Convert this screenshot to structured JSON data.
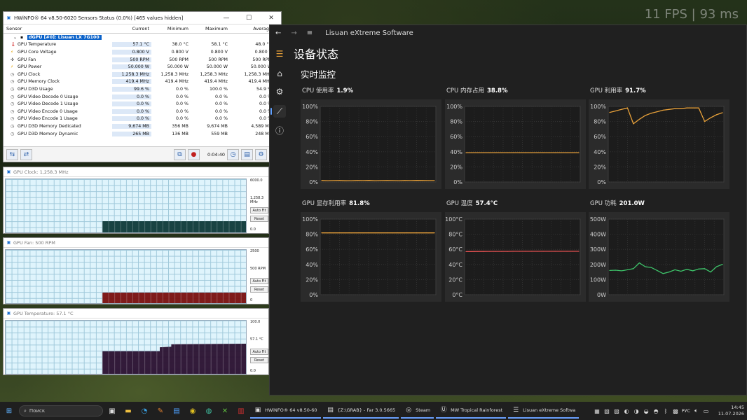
{
  "overlay": {
    "fps": "11 FPS | 93 ms"
  },
  "hwinfo": {
    "title": "HWiNFO® 64 v8.50-6020 Sensors Status (0.0%) [465 values hidden]",
    "columns": [
      "Sensor",
      "Current",
      "Minimum",
      "Maximum",
      "Average"
    ],
    "device": "dGPU [#0]: Lisuan LX 7G100",
    "rows": [
      {
        "name": "GPU Temperature",
        "icon": "thermometer-icon",
        "cur": "57.1 °C",
        "min": "38.0 °C",
        "max": "58.1 °C",
        "avg": "48.0 °C"
      },
      {
        "name": "GPU Core Voltage",
        "icon": "lightning-icon",
        "cur": "0.800 V",
        "min": "0.800 V",
        "max": "0.800 V",
        "avg": "0.800 V"
      },
      {
        "name": "GPU Fan",
        "icon": "fan-icon",
        "cur": "500 RPM",
        "min": "500 RPM",
        "max": "500 RPM",
        "avg": "500 RPM"
      },
      {
        "name": "GPU Power",
        "icon": "lightning-icon",
        "cur": "50.000 W",
        "min": "50.000 W",
        "max": "50.000 W",
        "avg": "50.000 W"
      },
      {
        "name": "GPU Clock",
        "icon": "clock-icon",
        "cur": "1,258.3 MHz",
        "min": "1,258.3 MHz",
        "max": "1,258.3 MHz",
        "avg": "1,258.3 MHz"
      },
      {
        "name": "GPU Memory Clock",
        "icon": "clock-icon",
        "cur": "419.4 MHz",
        "min": "419.4 MHz",
        "max": "419.4 MHz",
        "avg": "419.4 MHz"
      },
      {
        "name": "GPU D3D Usage",
        "icon": "clock-icon",
        "cur": "99.6 %",
        "min": "0.0 %",
        "max": "100.0 %",
        "avg": "54.9 %"
      },
      {
        "name": "GPU Video Decode 0 Usage",
        "icon": "clock-icon",
        "cur": "0.0 %",
        "min": "0.0 %",
        "max": "0.0 %",
        "avg": "0.0 %"
      },
      {
        "name": "GPU Video Decode 1 Usage",
        "icon": "clock-icon",
        "cur": "0.0 %",
        "min": "0.0 %",
        "max": "0.0 %",
        "avg": "0.0 %"
      },
      {
        "name": "GPU Video Encode 0 Usage",
        "icon": "clock-icon",
        "cur": "0.0 %",
        "min": "0.0 %",
        "max": "0.0 %",
        "avg": "0.0 %"
      },
      {
        "name": "GPU Video Encode 1 Usage",
        "icon": "clock-icon",
        "cur": "0.0 %",
        "min": "0.0 %",
        "max": "0.0 %",
        "avg": "0.0 %"
      },
      {
        "name": "GPU D3D Memory Dedicated",
        "icon": "clock-icon",
        "cur": "9,674 MB",
        "min": "356 MB",
        "max": "9,674 MB",
        "avg": "4,589 MB"
      },
      {
        "name": "GPU D3D Memory Dynamic",
        "icon": "clock-icon",
        "cur": "265 MB",
        "min": "136 MB",
        "max": "559 MB",
        "avg": "248 MB"
      }
    ],
    "timer": "0:04:40"
  },
  "graphs": [
    {
      "title": "GPU Clock: 1,258.3 MHz",
      "max": "6000.0",
      "cur": "1,258.3 MHz",
      "min": "0.0",
      "color": "#0f3a3a",
      "level": 0.21
    },
    {
      "title": "GPU Fan: 500 RPM",
      "max": "2500",
      "cur": "500 RPM",
      "min": "0",
      "color": "#7a1010",
      "level": 0.2
    },
    {
      "title": "GPU Temperature: 57.1 °C",
      "max": "100.0",
      "cur": "57.1 °C",
      "min": "0.0",
      "color": "#2a1030",
      "level": 0.571
    }
  ],
  "graph_buttons": {
    "autofit": "Auto Fit",
    "reset": "Reset"
  },
  "lisuan": {
    "app_title": "Lisuan eXtreme Software",
    "page_title": "设备状态",
    "section": "实时监控",
    "cards": [
      {
        "label": "CPU 使用率",
        "value": "1.9%",
        "ticks": [
          "100%",
          "80%",
          "60%",
          "40%",
          "20%",
          "0%"
        ],
        "color": "#e8a13a",
        "chart_data": {
          "type": "line",
          "ylim": [
            0,
            100
          ],
          "values": [
            2,
            1.8,
            1.9,
            2,
            1.7,
            1.8,
            2,
            1.9,
            2.1,
            1.8,
            1.9,
            2,
            1.9,
            1.8,
            2,
            1.9,
            2.1,
            2,
            1.9,
            1.9
          ]
        }
      },
      {
        "label": "CPU 内存占用",
        "value": "38.8%",
        "ticks": [
          "100%",
          "80%",
          "60%",
          "40%",
          "20%",
          "0%"
        ],
        "color": "#e8a13a",
        "chart_data": {
          "type": "line",
          "ylim": [
            0,
            100
          ],
          "values": [
            38.8,
            38.8,
            38.8,
            38.8,
            38.8,
            38.8,
            38.8,
            38.8,
            38.8,
            38.8,
            38.8,
            38.8,
            38.8,
            38.8,
            38.8,
            38.8,
            38.8,
            38.8,
            38.8,
            38.8
          ]
        }
      },
      {
        "label": "GPU 利用率",
        "value": "91.7%",
        "ticks": [
          "100%",
          "80%",
          "60%",
          "40%",
          "20%",
          "0%"
        ],
        "color": "#e8a13a",
        "chart_data": {
          "type": "line",
          "ylim": [
            0,
            100
          ],
          "values": [
            92,
            94,
            96,
            98,
            77,
            83,
            88,
            91,
            93,
            95,
            96,
            97,
            97,
            98,
            98,
            98,
            80,
            85,
            89,
            91.7
          ]
        }
      },
      {
        "label": "GPU 显存利用率",
        "value": "81.8%",
        "ticks": [
          "100%",
          "80%",
          "60%",
          "40%",
          "20%",
          "0%"
        ],
        "color": "#e8a13a",
        "chart_data": {
          "type": "line",
          "ylim": [
            0,
            100
          ],
          "values": [
            81.8,
            81.8,
            81.8,
            81.8,
            81.8,
            81.8,
            81.8,
            81.8,
            81.8,
            81.8,
            81.8,
            81.8,
            81.8,
            81.8,
            81.8,
            81.8,
            81.8,
            81.8,
            81.8,
            81.8
          ]
        }
      },
      {
        "label": "GPU 温度",
        "value": "57.4°C",
        "ticks": [
          "100°C",
          "80°C",
          "60°C",
          "40°C",
          "20°C",
          "0°C"
        ],
        "color": "#e05050",
        "chart_data": {
          "type": "line",
          "ylim": [
            0,
            100
          ],
          "values": [
            57,
            57.1,
            57.2,
            57.2,
            57.3,
            57.3,
            57.3,
            57.3,
            57.4,
            57.4,
            57.4,
            57.4,
            57.4,
            57.4,
            57.4,
            57.4,
            57.4,
            57.4,
            57.4,
            57.4
          ]
        }
      },
      {
        "label": "GPU 功耗",
        "value": "201.0W",
        "ticks": [
          "500W",
          "400W",
          "300W",
          "200W",
          "100W",
          "0W"
        ],
        "color": "#3ec46a",
        "chart_data": {
          "type": "line",
          "ylim": [
            0,
            500
          ],
          "values": [
            160,
            162,
            158,
            165,
            172,
            210,
            185,
            180,
            160,
            140,
            150,
            165,
            155,
            168,
            158,
            170,
            172,
            150,
            185,
            201
          ]
        }
      }
    ]
  },
  "taskbar": {
    "search": "Поиск",
    "tasks": [
      {
        "icon": "hwinfo-icon",
        "label": "HWiNFO® 64 v8.50-60",
        "open": true
      },
      {
        "icon": "far-icon",
        "label": "{Z:\\GRAB} - Far 3.0.5665",
        "open": true
      },
      {
        "icon": "steam-icon",
        "label": "Steam",
        "open": true
      },
      {
        "icon": "unreal-icon",
        "label": "MW Tropical Rainforest",
        "open": true
      },
      {
        "icon": "lisuan-icon",
        "label": "Lisuan eXtreme Softwa",
        "open": true
      }
    ],
    "lang": "РУС",
    "time": "14:45",
    "date": "11.07.2026"
  }
}
